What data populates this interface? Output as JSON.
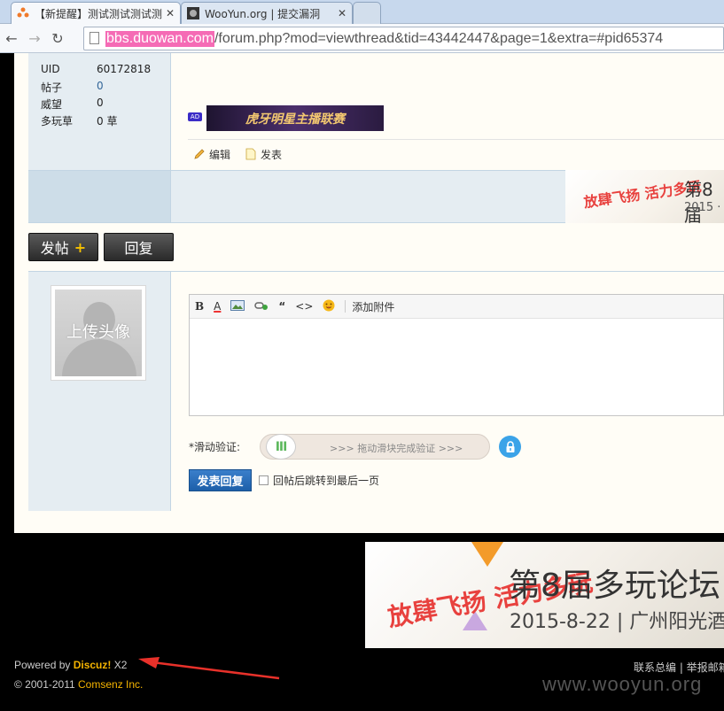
{
  "browser": {
    "tabs": [
      {
        "title": "【新提醒】测试测试测试测",
        "active": true
      },
      {
        "title": "WooYun.org | 提交漏洞",
        "active": false
      }
    ],
    "url_host": "bbs.duowan.com",
    "url_path": "/forum.php?mod=viewthread&tid=43442447&page=1&extra=#pid65374"
  },
  "profile": {
    "uid_label": "UID",
    "uid_value": "60172818",
    "posts_label": "帖子",
    "posts_value": "0",
    "prestige_label": "威望",
    "prestige_value": "0",
    "grass_label": "多玩草",
    "grass_value": "0 草"
  },
  "post": {
    "ad_badge": "AD",
    "ad_banner_text": "虎牙明星主播联赛",
    "edit_label": "编辑",
    "publish_label": "发表"
  },
  "mini_banner": {
    "title": "第8届",
    "date": "2015 ·",
    "logo": "放肆飞扬 活力多玩"
  },
  "buttons": {
    "new_post": "发帖",
    "new_post_icon": "+",
    "reply": "回复"
  },
  "reply": {
    "avatar_label": "上传头像",
    "toolbar": {
      "bold": "B",
      "color": "A",
      "attach": "添加附件"
    },
    "slider_label": "*滑动验证:",
    "slider_handle": "III",
    "slider_text": ">>> 拖动滑块完成验证 >>>",
    "submit": "发表回复",
    "checkbox_label": "回帖后跳转到最后一页"
  },
  "footer": {
    "banner_title": "第8届多玩论坛",
    "banner_date": "2015-8-22 | 广州阳光酒",
    "banner_logo": "放肆飞扬 活力多玩",
    "powered_prefix": "Powered by ",
    "powered_brand": "Discuz!",
    "powered_version": " X2",
    "copyright_prefix": "© 2001-2011 ",
    "copyright_company": "Comsenz Inc.",
    "links": "联系总编 | 举报邮箱",
    "watermark": "www.wooyun.org"
  },
  "colors": {
    "url_highlight": "#f56bb5",
    "brand": "#f5b400",
    "submit": "#2a6fbf",
    "arrow": "#e8312a"
  }
}
